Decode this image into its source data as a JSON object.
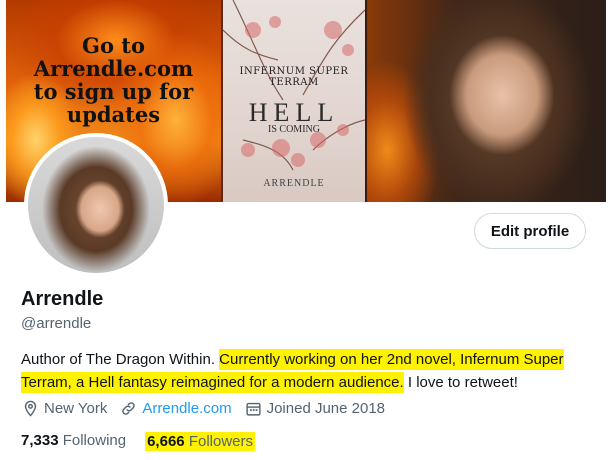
{
  "banner": {
    "promo_lines": [
      "Go to",
      "Arrendle.com",
      "to sign up for",
      "updates"
    ],
    "book_series_title": "INFERNUM SUPER TERRAM",
    "book_title": "HELL",
    "book_tagline": "IS COMING",
    "book_author": "ARRENDLE"
  },
  "profile": {
    "edit_button": "Edit profile",
    "name": "Arrendle",
    "handle": "@arrendle",
    "bio_plain_start": "Author of The Dragon Within. ",
    "bio_highlighted": "Currently working on her 2nd novel, Infernum Super Terram, a Hell fantasy reimagined for a modern audience.",
    "bio_plain_end": " I love to retweet!",
    "location": "New York",
    "website": "Arrendle.com",
    "joined": "Joined June 2018",
    "following_count": "7,333",
    "following_label": "Following",
    "followers_count": "6,666",
    "followers_label": "Followers"
  },
  "colors": {
    "highlight": "#fff200",
    "link": "#1d9bf0",
    "secondary_text": "#536471"
  }
}
